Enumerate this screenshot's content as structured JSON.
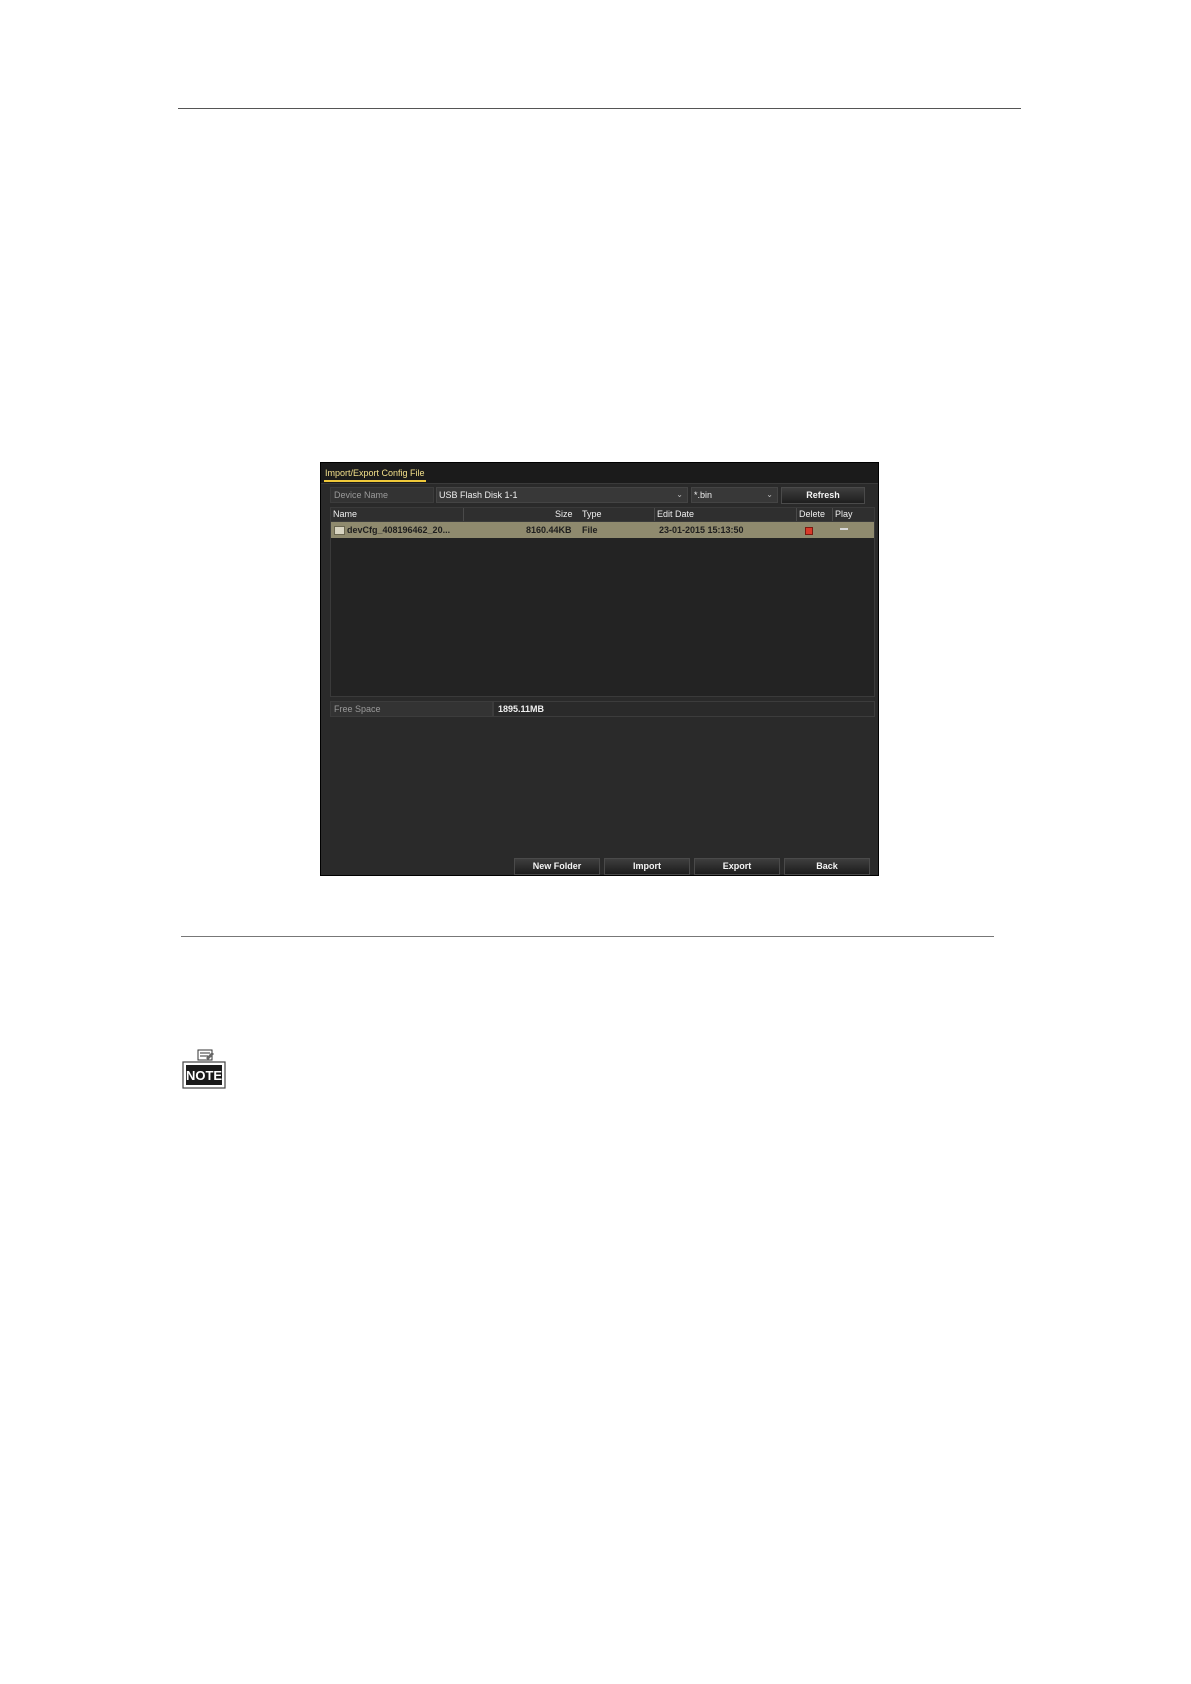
{
  "dialog": {
    "title_tab": "Import/Export Config File",
    "device_label": "Device Name",
    "device_value": "USB Flash Disk 1-1",
    "extension_value": "*.bin",
    "refresh_label": "Refresh",
    "columns": {
      "name": "Name",
      "size": "Size",
      "type": "Type",
      "edit_date": "Edit Date",
      "delete": "Delete",
      "play": "Play"
    },
    "files": [
      {
        "name": "devCfg_408196462_20...",
        "size": "8160.44KB",
        "type": "File",
        "edit_date": "23-01-2015 15:13:50"
      }
    ],
    "free_space_label": "Free Space",
    "free_space_value": "1895.11MB",
    "buttons": {
      "new_folder": "New Folder",
      "import": "Import",
      "export": "Export",
      "back": "Back"
    }
  },
  "note": {
    "badge_text": "NOTE",
    "icon": "note-icon"
  }
}
